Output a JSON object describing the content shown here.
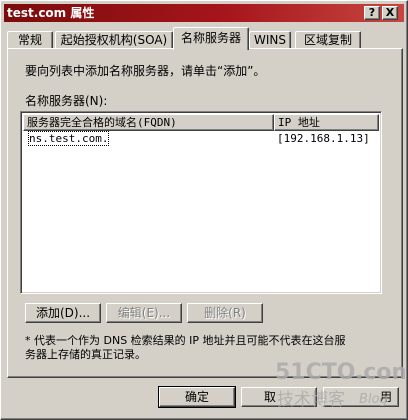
{
  "window": {
    "title": "test.com 属性",
    "help_button": "?",
    "close_button": "X"
  },
  "tabs": [
    {
      "label": "常规"
    },
    {
      "label": "起始授权机构(SOA)"
    },
    {
      "label": "名称服务器"
    },
    {
      "label": "WINS"
    },
    {
      "label": "区域复制"
    }
  ],
  "panel": {
    "instruction": "要向列表中添加名称服务器，请单击“添加”。",
    "list_label": "名称服务器(N):",
    "columns": [
      "服务器完全合格的域名(FQDN)",
      "IP 地址"
    ],
    "rows": [
      {
        "fqdn": "ns.test.com.",
        "ip": "[192.168.1.13]"
      }
    ],
    "buttons": {
      "add": "添加(D)...",
      "edit": "编辑(E)...",
      "remove": "删除(R)"
    },
    "footnote_line1": "* 代表一个作为 DNS 检索结果的 IP 地址并且可能不代表在这台服",
    "footnote_line2": "务器上存储的真正记录。"
  },
  "footer": {
    "ok": "确定",
    "cancel": "取",
    "apply": "用"
  },
  "watermark": {
    "site": "51CTO.com",
    "tagline": "技术博客",
    "blog": "Blog"
  },
  "colors": {
    "titlebar_start": "#7b0c0c",
    "titlebar_end": "#c8463f",
    "face": "#d4d0c8",
    "watermark": "#aaaaaa"
  }
}
